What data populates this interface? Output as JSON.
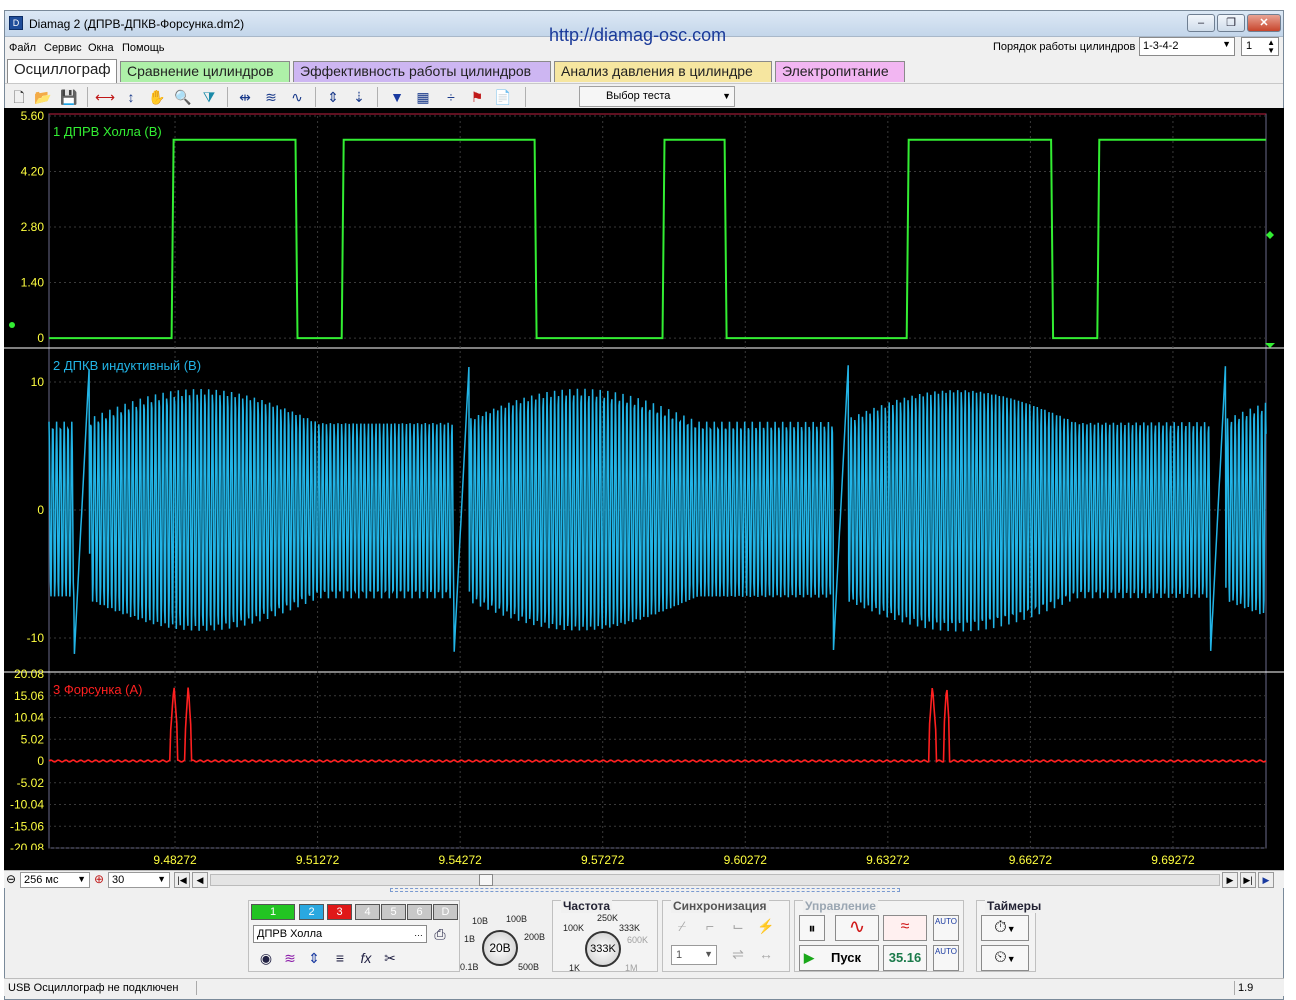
{
  "window": {
    "title": "Diamag 2 (ДПРВ-ДПКВ-Форсунка.dm2)",
    "url": "http://diamag-osc.com",
    "minimize": "–",
    "restore": "❐",
    "close": "✕"
  },
  "menu": [
    "Файл",
    "Сервис",
    "Окна",
    "Помощь"
  ],
  "cylinder_order": {
    "label": "Порядок работы цилиндров",
    "value": "1-3-4-2",
    "number": "1"
  },
  "tabs": [
    {
      "label": "Осциллограф",
      "color": "#ffffff"
    },
    {
      "label": "Сравнение цилиндров",
      "color": "#aef0a8"
    },
    {
      "label": "Эффективность работы цилиндров",
      "color": "#cdb6f2"
    },
    {
      "label": "Анализ давления в цилиндре",
      "color": "#f6e6a0"
    },
    {
      "label": "Электропитание",
      "color": "#f2b6f2"
    }
  ],
  "toolbar": {
    "test_select": "Выбор теста"
  },
  "chart_data": {
    "type": "line",
    "x_ticks": [
      "9.48272",
      "9.51272",
      "9.54272",
      "9.57272",
      "9.60272",
      "9.63272",
      "9.66272",
      "9.69272"
    ],
    "xlim": [
      9.4562,
      9.7123
    ],
    "channels": [
      {
        "name": "1 ДПРВ Холла (В)",
        "color": "#33ee33",
        "ylim": [
          -0.2,
          5.6
        ],
        "y_ticks": [
          "5.60",
          "4.20",
          "2.80",
          "1.40",
          "0"
        ],
        "low": 0,
        "high": 5.0,
        "high_intervals": [
          [
            9.482,
            9.5085
          ],
          [
            9.5178,
            9.5588
          ],
          [
            9.5853,
            9.5988
          ],
          [
            9.6367,
            9.6675
          ],
          [
            9.6768,
            9.7123
          ]
        ]
      },
      {
        "name": "2 ДПКВ индуктивный (В)",
        "color": "#22b4e6",
        "ylim": [
          -12.5,
          12.5
        ],
        "y_ticks": [
          "10",
          "0",
          "-10"
        ],
        "amplitude_min": 6.9,
        "amplitude_max": 9.5,
        "period": 0.0008,
        "sync_marks": [
          9.4631,
          9.543,
          9.6228,
          9.7022
        ]
      },
      {
        "name": "3 Форсунка (А)",
        "color": "#ff2020",
        "ylim": [
          -20.08,
          20.08
        ],
        "y_ticks": [
          "20.08",
          "15.06",
          "10.04",
          "5.02",
          "0",
          "-5.02",
          "-10.04",
          "-15.06",
          "-20.08"
        ],
        "pulses": [
          [
            9.4818,
            9.4832
          ],
          [
            9.4849,
            9.4861
          ],
          [
            9.6414,
            9.6428
          ],
          [
            9.6445,
            9.6457
          ]
        ],
        "pulse_peak": 17.5
      }
    ]
  },
  "timebase": {
    "value": "256 мс",
    "zoom": "30"
  },
  "channels_panel": {
    "buttons": [
      "1",
      "2",
      "3",
      "4",
      "5",
      "6",
      "D"
    ],
    "selected_channel": "ДПРВ Холла",
    "volts_labels": [
      "10В",
      "100В",
      "1В",
      "200В",
      "0.1В",
      "500В"
    ],
    "volts_value": "20В"
  },
  "frequency": {
    "title": "Частота",
    "labels": [
      "250K",
      "100K",
      "333K",
      "600K",
      "1K",
      "1M"
    ],
    "value": "333K"
  },
  "sync": {
    "title": "Синхронизация",
    "channel": "1"
  },
  "control": {
    "title": "Управление",
    "start": "Пуск",
    "rpm": "35.16"
  },
  "timers": {
    "title": "Таймеры"
  },
  "status": {
    "text": "USB Осциллограф не подключен",
    "version": "1.9"
  }
}
